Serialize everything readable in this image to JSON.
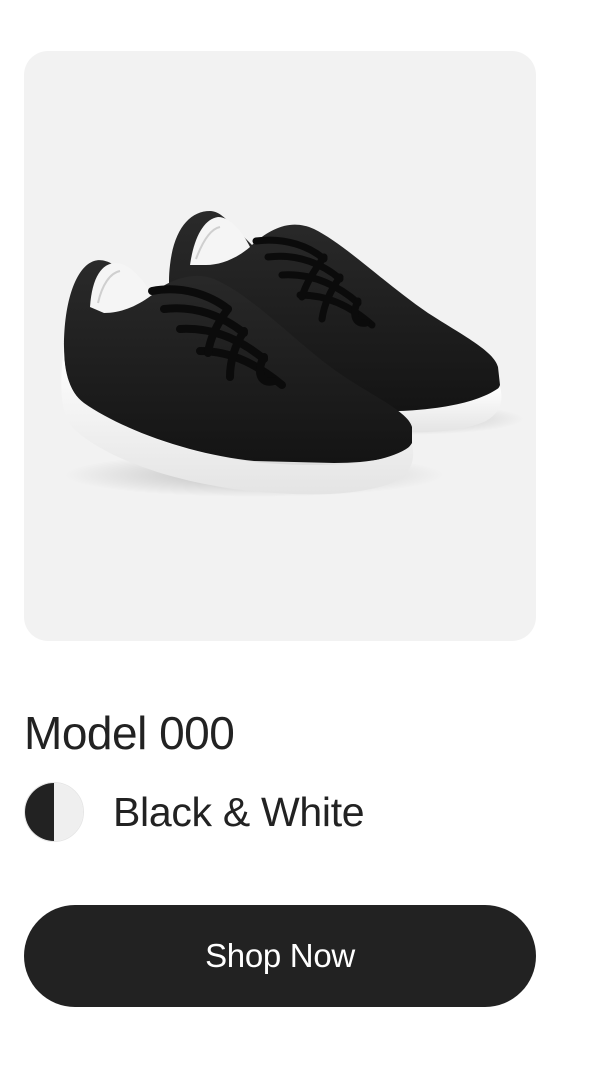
{
  "product": {
    "image_alt": "black knit sneakers with white soles",
    "title": "Model 000",
    "swatch": {
      "name": "Black & White",
      "colors": [
        "#222222",
        "#efefef"
      ]
    },
    "cta_label": "Shop Now"
  },
  "colors": {
    "text": "#222222",
    "image_background": "#f2f2f2",
    "button_background": "#222222",
    "button_text": "#ffffff"
  }
}
